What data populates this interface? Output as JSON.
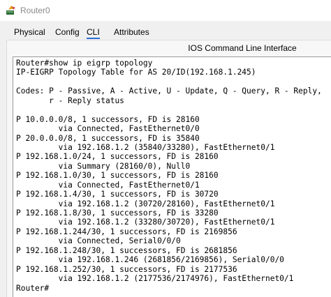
{
  "window": {
    "title": "Router0",
    "icon": "router-app-icon"
  },
  "tabs": [
    {
      "label": "Physical",
      "active": false
    },
    {
      "label": "Config",
      "active": false
    },
    {
      "label": "CLI",
      "active": true
    },
    {
      "label": "Attributes",
      "active": false
    }
  ],
  "cli": {
    "header": "IOS Command Line Interface",
    "lines": [
      "Router#show ip eigrp topology",
      "IP-EIGRP Topology Table for AS 20/ID(192.168.1.245)",
      "",
      "Codes: P - Passive, A - Active, U - Update, Q - Query, R - Reply,",
      "       r - Reply status",
      "",
      "P 10.0.0.0/8, 1 successors, FD is 28160",
      "         via Connected, FastEthernet0/0",
      "P 20.0.0.0/8, 1 successors, FD is 35840",
      "         via 192.168.1.2 (35840/33280), FastEthernet0/1",
      "P 192.168.1.0/24, 1 successors, FD is 28160",
      "         via Summary (28160/0), Null0",
      "P 192.168.1.0/30, 1 successors, FD is 28160",
      "         via Connected, FastEthernet0/1",
      "P 192.168.1.4/30, 1 successors, FD is 30720",
      "         via 192.168.1.2 (30720/28160), FastEthernet0/1",
      "P 192.168.1.8/30, 1 successors, FD is 33280",
      "         via 192.168.1.2 (33280/30720), FastEthernet0/1",
      "P 192.168.1.244/30, 1 successors, FD is 2169856",
      "         via Connected, Serial0/0/0",
      "P 192.168.1.248/30, 1 successors, FD is 2681856",
      "         via 192.168.1.246 (2681856/2169856), Serial0/0/0",
      "P 192.168.1.252/30, 1 successors, FD is 2177536",
      "         via 192.168.1.2 (2177536/2174976), FastEthernet0/1",
      "Router#"
    ]
  },
  "colors": {
    "active_tab_underline": "#2a6bd6",
    "title_text": "#8a8a8a",
    "terminal_bg": "#ffffff"
  }
}
